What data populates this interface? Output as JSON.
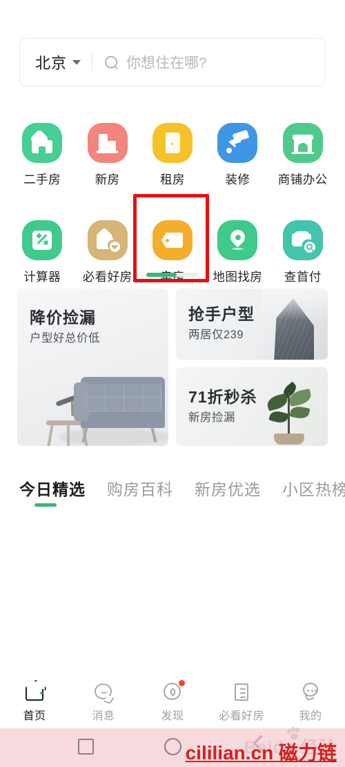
{
  "search": {
    "city": "北京",
    "placeholder": "你想住在哪?",
    "caret_icon": "chevron-down-icon",
    "search_icon": "search-icon"
  },
  "quick_actions": {
    "row1": [
      {
        "label": "二手房",
        "icon": "house-icon",
        "color": "#45cf93"
      },
      {
        "label": "新房",
        "icon": "buildings-icon",
        "color": "#f2857c"
      },
      {
        "label": "租房",
        "icon": "door-icon",
        "color": "#f5c22a"
      },
      {
        "label": "装修",
        "icon": "paint-roller-icon",
        "color": "#3f96e5"
      },
      {
        "label": "商铺办公",
        "icon": "storefront-icon",
        "color": "#4ecb8b"
      }
    ],
    "row2": [
      {
        "label": "计算器",
        "icon": "calculator-icon",
        "color": "#3ecb8c"
      },
      {
        "label": "必看好房",
        "icon": "house-heart-icon",
        "color": "#d6b577"
      },
      {
        "label": "卖房",
        "icon": "price-tag-icon",
        "color": "#f4ae2c"
      },
      {
        "label": "地图找房",
        "icon": "map-pin-icon",
        "color": "#3fc98a"
      },
      {
        "label": "查首付",
        "icon": "wallet-search-icon",
        "color": "#42c4ad"
      }
    ],
    "highlight": {
      "target_label": "卖房",
      "box_color": "#e60f10"
    },
    "progress": {
      "fill_color": "#3bb878",
      "track_color": "#ededed",
      "percent": 58
    }
  },
  "promos": {
    "left": {
      "title": "降价捡漏",
      "subtitle": "户型好总价低",
      "image": "living-room-sofa-telescope"
    },
    "right_top": {
      "title": "抢手户型",
      "subtitle": "两居仅239",
      "image": "skyscraper-in-mist"
    },
    "right_bottom": {
      "title": "71折秒杀",
      "subtitle": "新房捡漏",
      "image": "potted-plant"
    }
  },
  "tabs": {
    "items": [
      {
        "label": "今日精选",
        "active": true
      },
      {
        "label": "购房百科",
        "active": false
      },
      {
        "label": "新房优选",
        "active": false
      },
      {
        "label": "小区热榜",
        "active": false
      }
    ],
    "indicator_color": "#3bb878"
  },
  "bottom_nav": {
    "items": [
      {
        "label": "首页",
        "icon": "home-icon",
        "active": true,
        "badge": false
      },
      {
        "label": "消息",
        "icon": "chat-bubble-icon",
        "active": false,
        "badge": false
      },
      {
        "label": "发现",
        "icon": "compass-icon",
        "active": false,
        "badge": true
      },
      {
        "label": "必看好房",
        "icon": "document-icon",
        "active": false,
        "badge": false
      },
      {
        "label": "我的",
        "icon": "person-icon",
        "active": false,
        "badge": false
      }
    ],
    "badge_color": "#f4442e"
  },
  "system_bar": {
    "recents_icon": "square-recents-icon",
    "home_icon": "circle-home-icon",
    "back_icon": "back-chevron-icon",
    "watermark": "Baidu 经验",
    "footer_text": "cililian.cn 磁力链",
    "bar_color": "#f6dadd"
  }
}
